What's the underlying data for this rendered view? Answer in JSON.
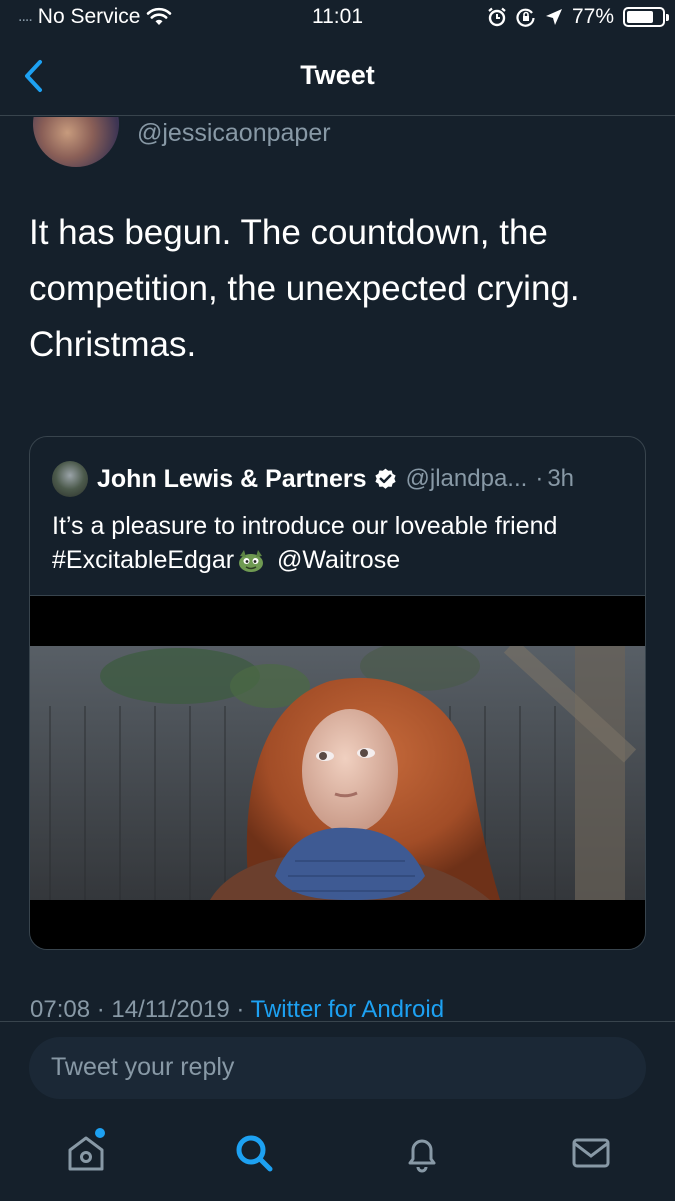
{
  "status_bar": {
    "signal": "....",
    "carrier": "No Service",
    "time": "11:01",
    "battery": "77%",
    "battery_level": 0.77
  },
  "nav": {
    "title": "Tweet",
    "back_icon": "chevron-left-icon"
  },
  "tweet": {
    "handle": "@jessicaonpaper",
    "text": "It has begun. The countdown, the competition, the unexpected crying. Christmas.",
    "timestamp": "07:08 · 14/11/2019 · ",
    "source": "Twitter for Android"
  },
  "quoted_tweet": {
    "name": "John Lewis & Partners",
    "handle": "@jlandpa...",
    "dot": "·",
    "time": "3h",
    "text_before": "It’s a pleasure to introduce our loveable friend #ExcitableEdgar",
    "text_after": " @Waitrose",
    "verified_icon": "verified-badge-icon"
  },
  "reply": {
    "placeholder": "Tweet your reply"
  },
  "tabs": [
    {
      "icon": "home-icon",
      "active": false
    },
    {
      "icon": "search-icon",
      "active": true
    },
    {
      "icon": "bell-icon",
      "active": false
    },
    {
      "icon": "mail-icon",
      "active": false
    }
  ],
  "colors": {
    "background": "#15202b",
    "accent": "#1da1f2",
    "secondary_text": "#8899a6",
    "border": "#38444d"
  }
}
